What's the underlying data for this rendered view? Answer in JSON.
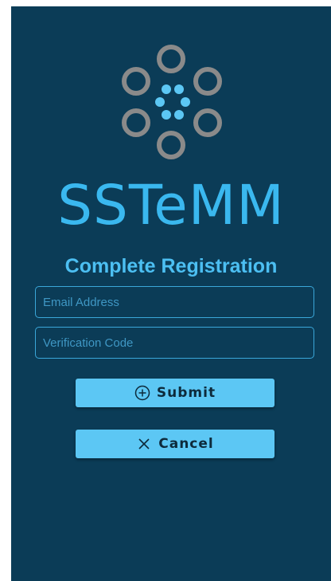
{
  "app": {
    "brand_name": "SSTeMM"
  },
  "form": {
    "title": "Complete Registration",
    "email_placeholder": "Email Address",
    "email_value": "",
    "code_placeholder": "Verification Code",
    "code_value": ""
  },
  "actions": {
    "submit_label": "Submit",
    "submit_icon": "plus-circle-icon",
    "cancel_label": "Cancel",
    "cancel_icon": "close-icon"
  },
  "colors": {
    "background": "#0b3c57",
    "accent": "#3ab8ef",
    "button": "#5cc7f4",
    "logo_ring": "#8a8a8a",
    "logo_dot": "#5cc7f4"
  }
}
